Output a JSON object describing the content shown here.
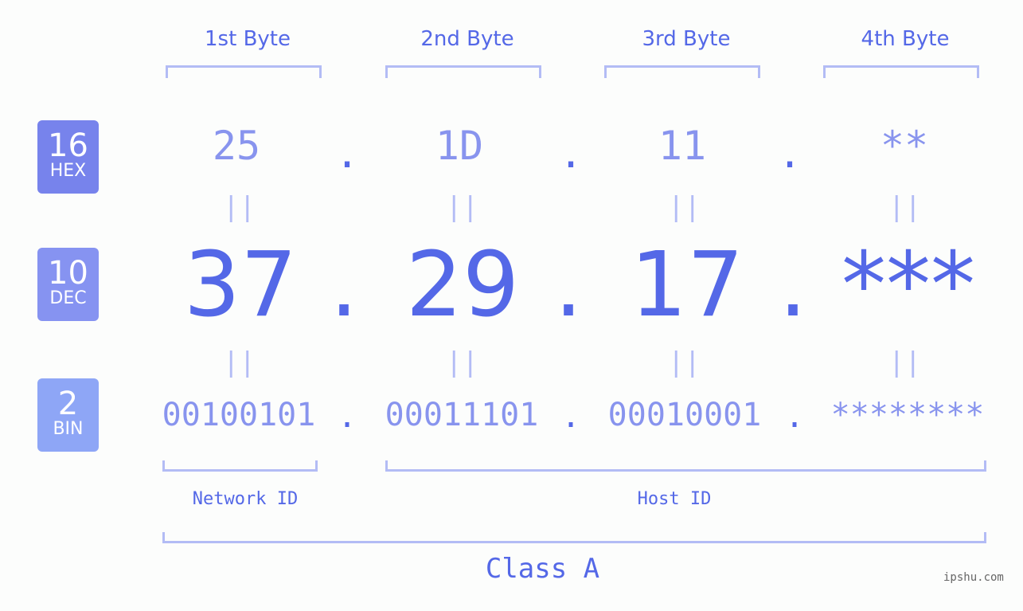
{
  "header": {
    "bytes": [
      "1st Byte",
      "2nd Byte",
      "3rd Byte",
      "4th Byte"
    ]
  },
  "badges": {
    "hex": {
      "num": "16",
      "label": "HEX",
      "color": "#7783ec"
    },
    "dec": {
      "num": "10",
      "label": "DEC",
      "color": "#8693f1"
    },
    "bin": {
      "num": "2",
      "label": "BIN",
      "color": "#8ea6f6"
    }
  },
  "rows": {
    "hex": [
      "25",
      "1D",
      "11",
      "**"
    ],
    "dec": [
      "37",
      "29",
      "17",
      "***"
    ],
    "bin": [
      "00100101",
      "00011101",
      "00010001",
      "********"
    ]
  },
  "separator": ".",
  "equals": "=",
  "labels": {
    "network_id": "Network ID",
    "host_id": "Host ID",
    "class": "Class A"
  },
  "watermark": "ipshu.com"
}
